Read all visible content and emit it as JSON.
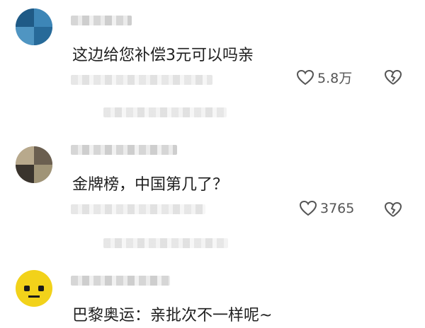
{
  "comments": [
    {
      "text": "这边给您补偿3元可以吗亲",
      "likes": "5.8万",
      "avatar_color": "#2b6e9e"
    },
    {
      "text": "金牌榜，中国第几了？",
      "likes": "3765",
      "avatar_color": "#8a7d6b"
    },
    {
      "text": "巴黎奥运：亲批次不一样呢~",
      "avatar_color": "#f2d21a"
    }
  ],
  "icons": [
    "heart-icon",
    "broken-heart-icon"
  ]
}
